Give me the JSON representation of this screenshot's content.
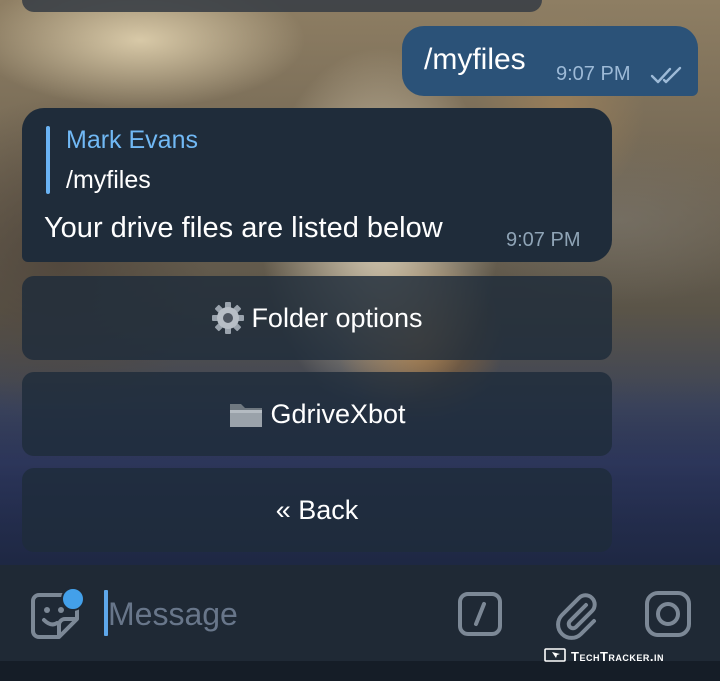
{
  "chat": {
    "outgoing": {
      "text": "/myfiles",
      "time": "9:07 PM",
      "status_icon": "double-check-icon"
    },
    "incoming": {
      "reply_to_name": "Mark Evans",
      "reply_to_text": "/myfiles",
      "text": "Your drive files are listed below",
      "time": "9:07 PM"
    }
  },
  "keyboard": {
    "buttons": [
      {
        "emoji": "gear-icon",
        "label": "Folder options"
      },
      {
        "emoji": "folder-icon",
        "label": "GdriveXbot"
      },
      {
        "label": "« Back"
      }
    ]
  },
  "input_bar": {
    "placeholder": "Message",
    "icons": [
      "sticker-icon",
      "bot-command-icon",
      "attach-icon",
      "camera-icon"
    ]
  },
  "watermark": {
    "text": "TechTracker.in"
  },
  "colors": {
    "outgoing_bubble": "#2b5278",
    "incoming_bubble": "#1f2c3a",
    "accent": "#6ab3f3",
    "input_bar": "#1f2935"
  }
}
